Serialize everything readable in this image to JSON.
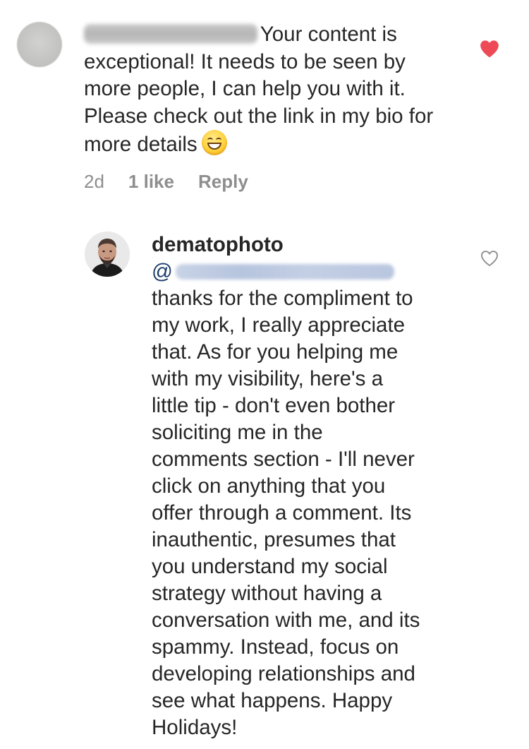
{
  "comment": {
    "username": "motivationigspecialist",
    "text": "Your content is exceptional! It needs to be seen by more people, I can help you with it. Please check out the link in my bio for more details",
    "emoji": "grinning-face-with-smiling-eyes",
    "time": "2d",
    "likes": "1 like",
    "reply_label": "Reply",
    "liked": true
  },
  "reply": {
    "username": "dematophoto",
    "mention_prefix": "@",
    "mention": "motivationigspecialist",
    "text": "thanks for the compliment to\nmy work, I really appreciate\nthat. As for you helping me\nwith my visibility, here's a\nlittle tip - don't even bother\nsoliciting me in the\ncomments section - I'll never\nclick on anything that you\noffer through a comment. Its\ninauthentic, presumes that\nyou understand my social\nstrategy without having a\nconversation with me, and its\nspammy. Instead, focus on\ndeveloping relationships and\nsee what happens. Happy\nHolidays!",
    "liked": false
  },
  "colors": {
    "text": "#262626",
    "meta": "#8e8e8e",
    "heart": "#ed4956",
    "mention": "#1d3e6b"
  }
}
